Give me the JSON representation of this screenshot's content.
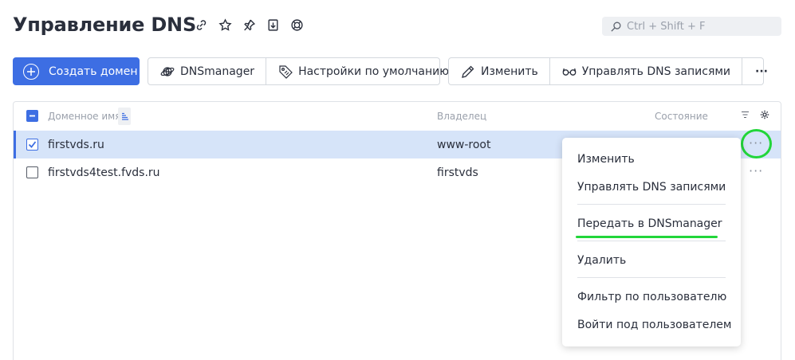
{
  "header": {
    "title": "Управление DNS",
    "icons": [
      "link-icon",
      "star-icon",
      "pin-icon",
      "export-icon",
      "lifebuoy-icon"
    ],
    "search_placeholder": "Ctrl + Shift + F"
  },
  "toolbar": {
    "create_label": "Создать домен",
    "dnsmanager_label": "DNSmanager",
    "defaults_label": "Настройки по умолчанию",
    "edit_label": "Изменить",
    "manage_dns_label": "Управлять DNS записями",
    "more_label": "···"
  },
  "table": {
    "columns": {
      "domain": "Доменное имя",
      "owner": "Владелец",
      "status": "Состояние"
    },
    "rows": [
      {
        "domain": "firstvds.ru",
        "owner": "www-root",
        "selected": true
      },
      {
        "domain": "firstvds4test.fvds.ru",
        "owner": "firstvds",
        "selected": false
      }
    ],
    "row_actions_label": "···"
  },
  "context_menu": {
    "items": [
      "Изменить",
      "Управлять DNS записями",
      "Передать в DNSmanager",
      "Удалить",
      "Фильтр по пользователю",
      "Войти под пользователем"
    ]
  },
  "colors": {
    "accent": "#3d6ee3",
    "selected_row": "#d6e4f9",
    "highlight": "#22d63a"
  }
}
